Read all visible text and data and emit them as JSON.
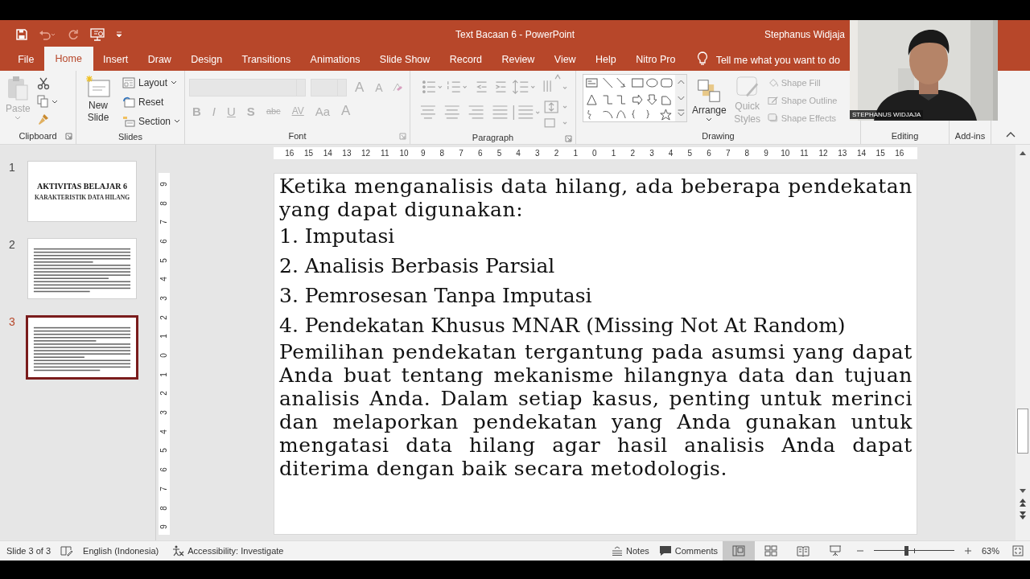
{
  "window": {
    "title": "Text Bacaan 6  -  PowerPoint",
    "user": "Stephanus Widjaja"
  },
  "tabs": [
    {
      "label": "File",
      "selected": false
    },
    {
      "label": "Home",
      "selected": true
    },
    {
      "label": "Insert",
      "selected": false
    },
    {
      "label": "Draw",
      "selected": false
    },
    {
      "label": "Design",
      "selected": false
    },
    {
      "label": "Transitions",
      "selected": false
    },
    {
      "label": "Animations",
      "selected": false
    },
    {
      "label": "Slide Show",
      "selected": false
    },
    {
      "label": "Record",
      "selected": false
    },
    {
      "label": "Review",
      "selected": false
    },
    {
      "label": "View",
      "selected": false
    },
    {
      "label": "Help",
      "selected": false
    },
    {
      "label": "Nitro Pro",
      "selected": false
    }
  ],
  "tell_me": {
    "placeholder": "Tell me what you want to do"
  },
  "ribbon": {
    "clipboard": {
      "label": "Clipboard",
      "paste": {
        "label": "Paste",
        "disabled": true
      }
    },
    "slides": {
      "label": "Slides",
      "new_slide": "New Slide",
      "layout": "Layout",
      "reset": "Reset",
      "section": "Section"
    },
    "font": {
      "label": "Font",
      "disabled": true,
      "grow": "A",
      "shrink": "A",
      "buttons": [
        {
          "label": "B",
          "kind": "bold"
        },
        {
          "label": "I",
          "kind": "italic"
        },
        {
          "label": "U",
          "kind": "underline"
        },
        {
          "label": "S",
          "kind": "shadow"
        },
        {
          "label": "abc",
          "kind": "strike"
        },
        {
          "label": "AV",
          "kind": "spacing"
        },
        {
          "label": "Aa",
          "kind": "case"
        },
        {
          "label": "A",
          "kind": "color"
        }
      ]
    },
    "paragraph": {
      "label": "Paragraph"
    },
    "drawing": {
      "label": "Drawing",
      "arrange": "Arrange",
      "quick_styles": {
        "label": "Quick Styles",
        "disabled": true
      },
      "shape_commands": [
        {
          "label": "Shape Fill",
          "kind": "fill",
          "disabled": true
        },
        {
          "label": "Shape Outline",
          "kind": "outline",
          "disabled": true
        },
        {
          "label": "Shape Effects",
          "kind": "effects",
          "disabled": true
        }
      ]
    },
    "editing": {
      "label": "Editing"
    },
    "addins": {
      "label": "Add-ins"
    }
  },
  "webcam": {
    "name_label": "STEPHANUS WIDJAJA"
  },
  "thumbnails": [
    {
      "number": "1",
      "selected": false,
      "title": "AKTIVITAS BELAJAR 6",
      "subtitle": "KARAKTERISTIK DATA HILANG"
    },
    {
      "number": "2",
      "selected": false
    },
    {
      "number": "3",
      "selected": true
    }
  ],
  "ruler": {
    "horizontal": [
      "16",
      "15",
      "14",
      "13",
      "12",
      "11",
      "10",
      "9",
      "8",
      "7",
      "6",
      "5",
      "4",
      "3",
      "2",
      "1",
      "0",
      "1",
      "2",
      "3",
      "4",
      "5",
      "6",
      "7",
      "8",
      "9",
      "10",
      "11",
      "12",
      "13",
      "14",
      "15",
      "16"
    ],
    "vertical": [
      "9",
      "8",
      "7",
      "6",
      "5",
      "4",
      "3",
      "2",
      "1",
      "0",
      "1",
      "2",
      "3",
      "4",
      "5",
      "6",
      "7",
      "8",
      "9"
    ]
  },
  "slide": {
    "intro": "Ketika menganalisis data hilang, ada beberapa pendekatan yang dapat digunakan:",
    "list": [
      "1. Imputasi",
      "2. Analisis Berbasis Parsial",
      "3. Pemrosesan Tanpa Imputasi",
      "4. Pendekatan Khusus MNAR (Missing Not At Random)"
    ],
    "paragraph": "Pemilihan pendekatan tergantung pada asumsi yang dapat Anda buat tentang mekanisme hilangnya data dan tujuan analisis Anda. Dalam setiap kasus, penting untuk merinci dan melaporkan pendekatan yang Anda gunakan untuk mengatasi data hilang agar hasil analisis Anda dapat diterima dengan baik secara metodologis."
  },
  "status_bar": {
    "slide_info": "Slide 3 of 3",
    "language": "English (Indonesia)",
    "accessibility": "Accessibility: Investigate",
    "notes": "Notes",
    "comments": "Comments",
    "views": [
      {
        "kind": "normal",
        "selected": true
      },
      {
        "kind": "sorter",
        "selected": false
      },
      {
        "kind": "reading",
        "selected": false
      },
      {
        "kind": "slideshow",
        "selected": false
      }
    ],
    "zoom": {
      "level": 0.4,
      "reading": "63%"
    }
  }
}
